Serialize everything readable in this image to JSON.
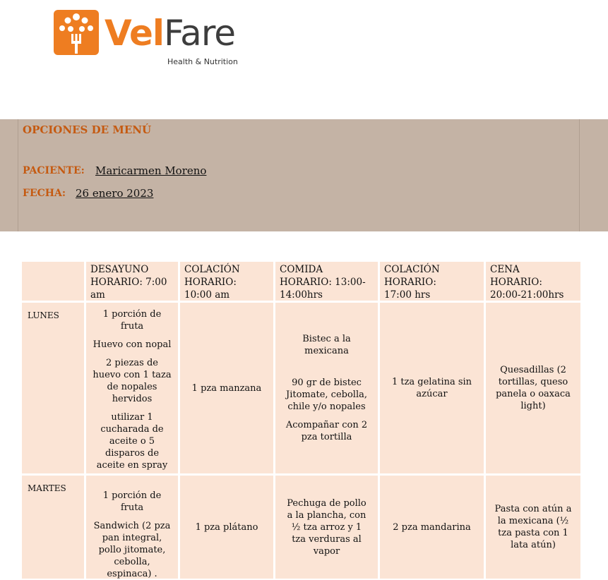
{
  "brand": {
    "name_part1": "Vel",
    "name_part2": "Fare",
    "tagline": "Health & Nutrition",
    "accent_color": "#ee7d21"
  },
  "header": {
    "title": "OPCIONES DE MENÚ",
    "patient_label": "PACIENTE:",
    "patient_name": "Maricarmen Moreno",
    "date_label": "FECHA:",
    "date_value": "26  enero 2023",
    "band_color": "#c4b3a5"
  },
  "menu": {
    "columns": [
      {
        "l1": "DESAYUNO",
        "l2": "HORARIO: 7:00",
        "l3": "am"
      },
      {
        "l1": "COLACIÓN",
        "l2": "HORARIO:",
        "l3": "10:00 am"
      },
      {
        "l1": "COMIDA",
        "l2": "HORARIO: 13:00-",
        "l3": "14:00hrs"
      },
      {
        "l1": "COLACIÓN",
        "l2": "HORARIO:",
        "l3": "17:00 hrs"
      },
      {
        "l1": "CENA",
        "l2": "HORARIO:",
        "l3": " 20:00-21:00hrs"
      }
    ],
    "rows": [
      {
        "day": "LUNES",
        "desayuno": [
          "1 porción de fruta",
          "Huevo con nopal",
          "2 piezas de huevo con 1 taza de nopales hervidos",
          "utilizar 1 cucharada de aceite o 5 disparos de aceite en spray"
        ],
        "colacion1": [
          "1 pza manzana"
        ],
        "comida": [
          "Bistec a la mexicana",
          "90 gr de bistec Jitomate, cebolla, chile y/o nopales",
          "Acompañar con 2 pza tortilla"
        ],
        "colacion2": [
          "1 tza gelatina sin azúcar"
        ],
        "cena": [
          "Quesadillas (2 tortillas, queso panela o oaxaca light)"
        ]
      },
      {
        "day": "MARTES",
        "desayuno": [
          "1 porción de fruta",
          "Sandwich (2 pza pan integral, pollo jitomate, cebolla, espinaca) ."
        ],
        "colacion1": [
          "1 pza plátano"
        ],
        "comida": [
          "Pechuga de pollo a la plancha, con ½ tza arroz y 1  tza verduras al vapor"
        ],
        "colacion2": [
          "2 pza mandarina"
        ],
        "cena": [
          "Pasta con atún a la mexicana (½ tza pasta con 1 lata atún)"
        ]
      }
    ],
    "cell_color": "#fbe4d5"
  }
}
